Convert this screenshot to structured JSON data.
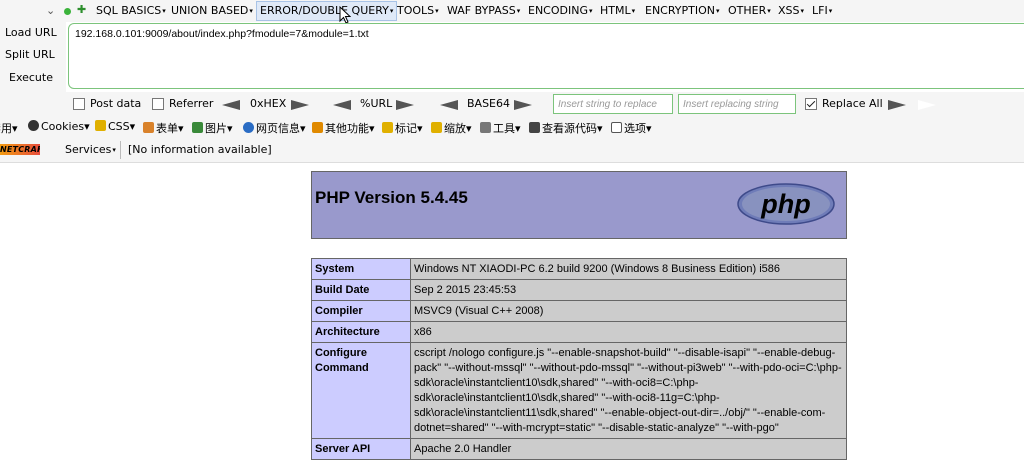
{
  "hackbar": {
    "menu": [
      {
        "id": "sql-basics",
        "label": "SQL BASICS"
      },
      {
        "id": "union-based",
        "label": "UNION BASED"
      },
      {
        "id": "error-double-query",
        "label": "ERROR/DOUBLE QUERY"
      },
      {
        "id": "tools",
        "label": "TOOLS"
      },
      {
        "id": "waf-bypass",
        "label": "WAF BYPASS"
      },
      {
        "id": "encoding",
        "label": "ENCODING"
      },
      {
        "id": "html",
        "label": "HTML"
      },
      {
        "id": "encryption",
        "label": "ENCRYPTION"
      },
      {
        "id": "other",
        "label": "OTHER"
      },
      {
        "id": "xss",
        "label": "XSS"
      },
      {
        "id": "lfi",
        "label": "LFI"
      }
    ],
    "load_url": "Load URL",
    "split_url": "Split URL",
    "execute": "Execute",
    "url_value": "192.168.0.101:9009/about/index.php?fmodule=7&module=1.txt",
    "post_data": "Post data",
    "referrer": "Referrer",
    "hex": "0xHEX",
    "url_enc": "%URL",
    "base64": "BASE64",
    "replace_placeholder": "Insert string to replace",
    "replacing_placeholder": "Insert replacing string",
    "replace_all": "Replace All"
  },
  "cn_toolbar": {
    "items": [
      {
        "id": "disable",
        "label": "禁用"
      },
      {
        "id": "cookies",
        "label": "Cookies"
      },
      {
        "id": "css",
        "label": "CSS"
      },
      {
        "id": "forms",
        "label": "表单"
      },
      {
        "id": "images",
        "label": "图片"
      },
      {
        "id": "page-info",
        "label": "网页信息"
      },
      {
        "id": "misc",
        "label": "其他功能"
      },
      {
        "id": "mark",
        "label": "标记"
      },
      {
        "id": "resize",
        "label": "缩放"
      },
      {
        "id": "tools",
        "label": "工具"
      },
      {
        "id": "view-source",
        "label": "查看源代码"
      },
      {
        "id": "options",
        "label": "选项"
      }
    ]
  },
  "netcraft": {
    "logo_text": "NETCRAFT",
    "services": "Services",
    "info": "[No information available]"
  },
  "php": {
    "title": "PHP Version 5.4.45",
    "logo": "php",
    "rows": [
      {
        "key": "System",
        "value": "Windows NT XIAODI-PC 6.2 build 9200 (Windows 8 Business Edition) i586"
      },
      {
        "key": "Build Date",
        "value": "Sep 2 2015 23:45:53"
      },
      {
        "key": "Compiler",
        "value": "MSVC9 (Visual C++ 2008)"
      },
      {
        "key": "Architecture",
        "value": "x86"
      },
      {
        "key": "Configure Command",
        "value": "cscript /nologo configure.js \"--enable-snapshot-build\" \"--disable-isapi\" \"--enable-debug-pack\" \"--without-mssql\" \"--without-pdo-mssql\" \"--without-pi3web\" \"--with-pdo-oci=C:\\php-sdk\\oracle\\instantclient10\\sdk,shared\" \"--with-oci8=C:\\php-sdk\\oracle\\instantclient10\\sdk,shared\" \"--with-oci8-11g=C:\\php-sdk\\oracle\\instantclient11\\sdk,shared\" \"--enable-object-out-dir=../obj/\" \"--enable-com-dotnet=shared\" \"--with-mcrypt=static\" \"--disable-static-analyze\" \"--with-pgo\""
      },
      {
        "key": "Server API",
        "value": "Apache 2.0 Handler"
      }
    ]
  }
}
